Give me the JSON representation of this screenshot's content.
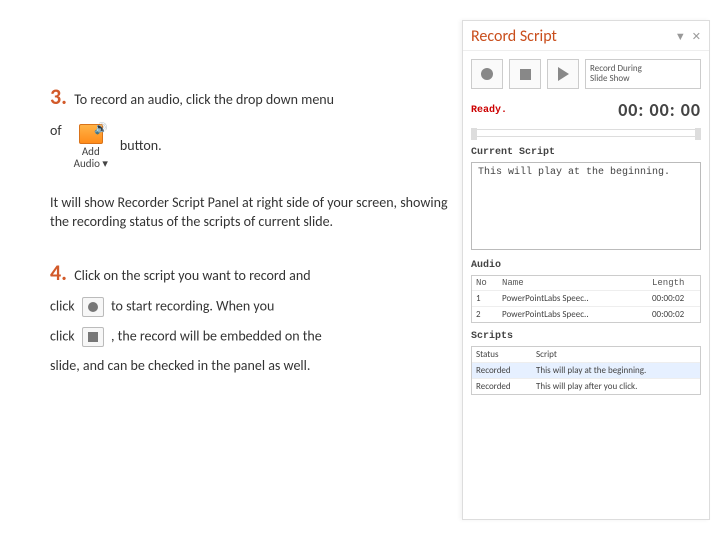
{
  "left": {
    "step3num": "3.",
    "step3text": "To record an audio, click the drop down menu",
    "of_text": "of",
    "add_audio_line1": "Add",
    "add_audio_line2": "Audio ▾",
    "button_text": "button.",
    "step3para": "It will show Recorder Script Panel at right side of your screen, showing the recording status of the scripts of current slide.",
    "step4num": "4.",
    "step4text": "Click on the script you want to record and",
    "click1_pre": "click",
    "click1_post": "to start recording. When you",
    "click2_pre": "click",
    "click2_post": ", the record will be embedded on the",
    "step4end": "slide, and can be checked in the panel as well."
  },
  "panel": {
    "title": "Record Script",
    "minimize": "▼",
    "close": "✕",
    "rec_during_1": "Record During",
    "rec_during_2": "Slide Show",
    "ready": "Ready.",
    "timer": "00: 00: 00",
    "current_script_label": "Current Script",
    "current_script_text": "This will play at the beginning.",
    "audio_label": "Audio",
    "audio_headers": {
      "no": "No",
      "name": "Name",
      "length": "Length"
    },
    "audio_rows": [
      {
        "no": "1",
        "name": "PowerPointLabs Speec..",
        "length": "00:00:02"
      },
      {
        "no": "2",
        "name": "PowerPointLabs Speec..",
        "length": "00:00:02"
      }
    ],
    "scripts_label": "Scripts",
    "scripts_headers": {
      "status": "Status",
      "script": "Script"
    },
    "scripts_rows": [
      {
        "status": "Recorded",
        "script": "This will play at the beginning.",
        "selected": true
      },
      {
        "status": "Recorded",
        "script": "This will play after you click."
      }
    ]
  }
}
